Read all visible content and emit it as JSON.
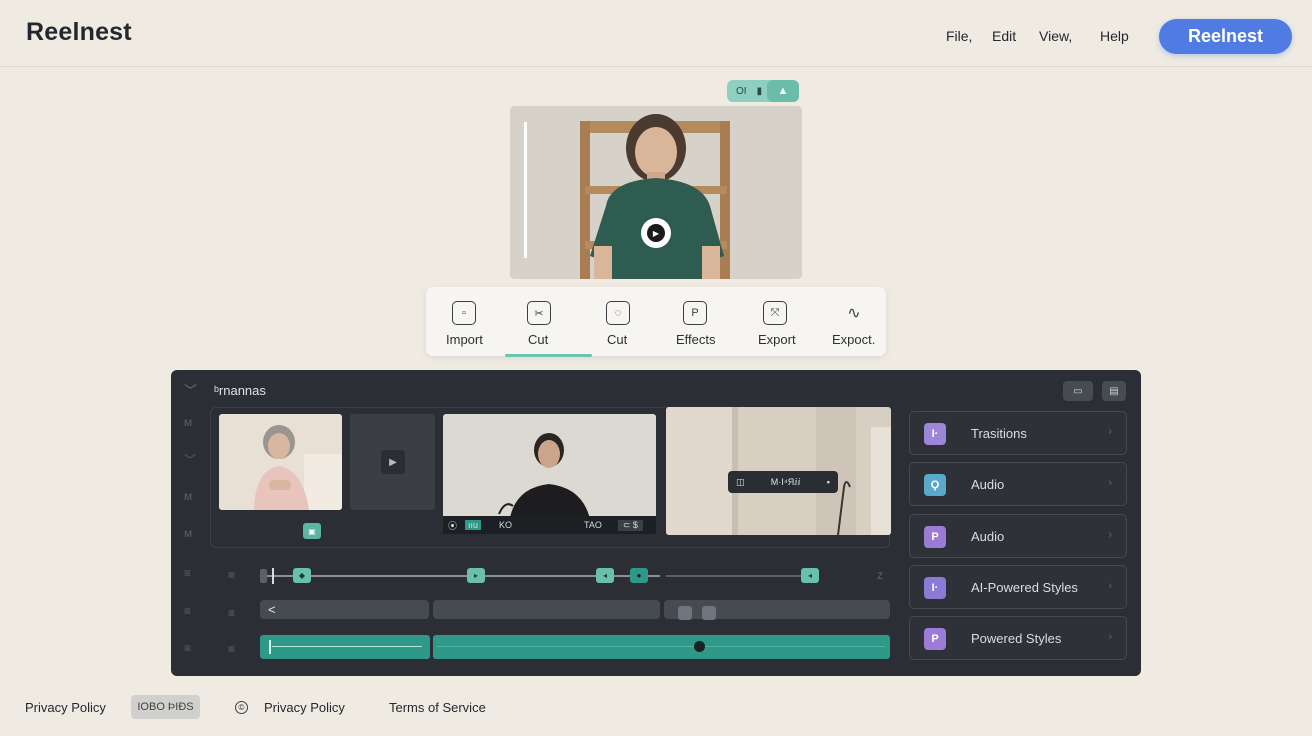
{
  "header": {
    "brand": "Reelnest",
    "menu": [
      "File,",
      "Edit",
      "View,",
      "Help"
    ],
    "cta_label": "Reelnest"
  },
  "preview": {
    "pill_text": "OI"
  },
  "toolbar": {
    "tools": [
      {
        "label": "Import",
        "icon": "import-icon"
      },
      {
        "label": "Cut",
        "icon": "scissors-icon"
      },
      {
        "label": "Cut",
        "icon": "cut-icon"
      },
      {
        "label": "Effects",
        "icon": "effects-icon"
      },
      {
        "label": "Export",
        "icon": "export-icon"
      },
      {
        "label": "Expoct.",
        "icon": "wave-icon"
      }
    ]
  },
  "editor": {
    "title": "ᵇrnannas",
    "clip2_caption_left": "ııu",
    "clip2_caption_mid": "KO",
    "clip2_caption_right": "TAO",
    "overlay_chip_text": "M·ⵏ⁴Яⅈⅈ"
  },
  "side_panel": {
    "items": [
      {
        "label": "Trasitions",
        "color": "#9b86d8",
        "glyph": "I·"
      },
      {
        "label": "Audio",
        "color": "#5aa9c9",
        "glyph": "Ϙ"
      },
      {
        "label": "Audio",
        "color": "#9b7bd6",
        "glyph": "P"
      },
      {
        "label": "AI-Powered Styles",
        "color": "#8b7ad6",
        "glyph": "I·"
      },
      {
        "label": "Powered Styles",
        "color": "#9d7bd8",
        "glyph": "P"
      }
    ]
  },
  "footer": {
    "link1": "Privacy Policy",
    "chip": "IOBO ÞIÐS",
    "link2": "Privacy Policy",
    "link3": "Terms of Service"
  }
}
